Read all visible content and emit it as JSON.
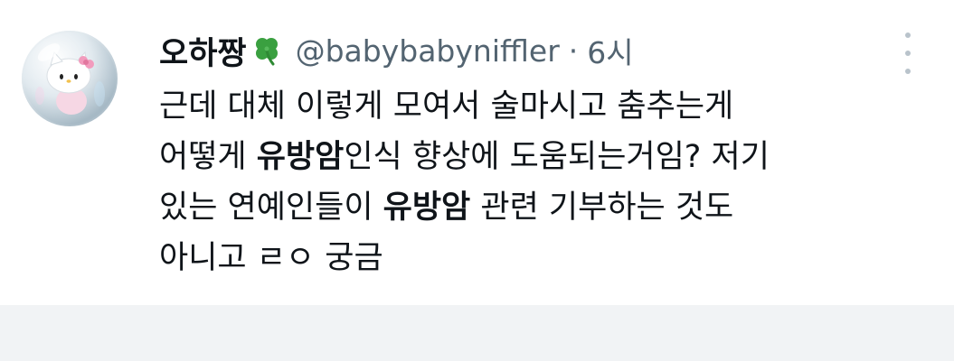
{
  "tweet": {
    "display_name": "오하짱",
    "name_emoji_icon": "four-leaf-clover-icon",
    "handle": "@babybabyniffler",
    "separator": "·",
    "time": "6시",
    "avatar_icon": "hello-kitty-bubble-avatar",
    "more_icon": "vertical-ellipsis-icon",
    "lines": [
      {
        "segments": [
          {
            "text": "근데 대체 이렇게 모여서 술마시고 춤추는게"
          }
        ]
      },
      {
        "segments": [
          {
            "text": "어떻게 "
          },
          {
            "text": "유방암"
          },
          {
            "text": "인식 향상에 도움되는거임? 저기"
          }
        ]
      },
      {
        "segments": [
          {
            "text": "있는 연예인들이 "
          },
          {
            "text": "유방암"
          },
          {
            "text": " 관련 기부하는 것도"
          }
        ]
      },
      {
        "segments": [
          {
            "text": "아니고 ㄹㅇ 궁금"
          }
        ]
      }
    ]
  },
  "colors": {
    "text": "#0f1419",
    "secondary": "#536471",
    "footer_band": "#f1f3f5",
    "clover": "#3aa040"
  }
}
